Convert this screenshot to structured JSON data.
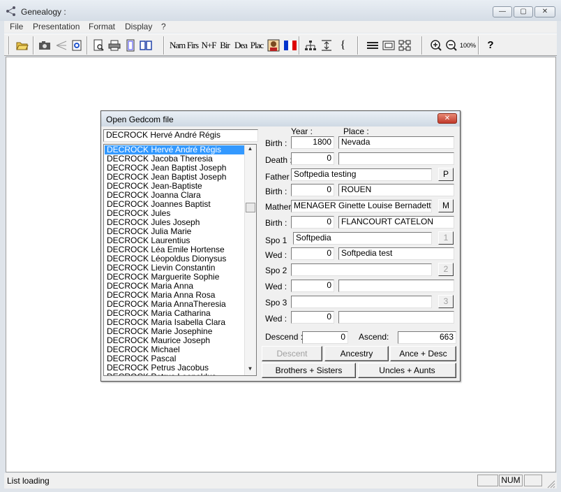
{
  "window": {
    "title": "Genealogy :"
  },
  "window_buttons": {
    "minimize": "—",
    "maximize": "▢",
    "close": "✕"
  },
  "menu": [
    "File",
    "Presentation",
    "Format",
    "Display",
    "?"
  ],
  "toolbar": {
    "name_label": "Nam",
    "first_label": "Firs",
    "nf_label": "N+F",
    "birth_label": "Bir",
    "death_label": "Dea",
    "place_label": "Plac",
    "zoom100_label": "100%",
    "brace_label": "{",
    "help_label": "?"
  },
  "dialog": {
    "title": "Open Gedcom file",
    "search_value": "DECROCK Hervé André Régis",
    "list_items": [
      "DECROCK Hervé André Régis",
      "DECROCK Jacoba Theresia",
      "DECROCK Jean Baptist Joseph",
      "DECROCK Jean Baptist Joseph",
      "DECROCK Jean-Baptiste",
      "DECROCK Joanna Clara",
      "DECROCK Joannes Baptist",
      "DECROCK Jules",
      "DECROCK Jules Joseph",
      "DECROCK Julia Marie",
      "DECROCK Laurentius",
      "DECROCK Léa Emile Hortense",
      "DECROCK Léopoldus Dionysus",
      "DECROCK Lievin Constantin",
      "DECROCK Marguerite Sophie",
      "DECROCK Maria Anna",
      "DECROCK Maria Anna Rosa",
      "DECROCK Maria AnnaTheresia",
      "DECROCK Maria Catharina",
      "DECROCK Maria Isabella Clara",
      "DECROCK Marie Josephine",
      "DECROCK Maurice Joseph",
      "DECROCK Michael",
      "DECROCK Pascal",
      "DECROCK Petrus Jacobus",
      "DECROCK Petrus Leopoldus"
    ],
    "year_header": "Year :",
    "place_header": "Place :",
    "birth_label": "Birth :",
    "birth_year": "1800",
    "birth_place": "Nevada",
    "death_label": "Death :",
    "death_year": "0",
    "death_place": "",
    "father_label": "Father :",
    "father_value": "Softpedia testing",
    "father_btn": "P",
    "father_birth_label": "Birth :",
    "father_birth_year": "0",
    "father_birth_place": "ROUEN",
    "mother_label": "Mather",
    "mother_value": "MENAGER Ginette Louise Bernadette",
    "mother_btn": "M",
    "mother_birth_label": "Birth :",
    "mother_birth_year": "0",
    "mother_birth_place": "FLANCOURT CATELON",
    "spouse1_label": "Spo 1",
    "spouse1_value": "Softpedia",
    "spouse1_btn": "1",
    "wed1_label": "Wed :",
    "wed1_year": "0",
    "wed1_place": "Softpedia test",
    "spouse2_label": "Spo 2",
    "spouse2_value": "",
    "spouse2_btn": "2",
    "wed2_label": "Wed :",
    "wed2_year": "0",
    "wed2_place": "",
    "spouse3_label": "Spo 3",
    "spouse3_value": "",
    "spouse3_btn": "3",
    "wed3_label": "Wed :",
    "wed3_year": "0",
    "wed3_place": "",
    "descend_label": "Descend :",
    "descend_value": "0",
    "ascend_label": "Ascend:",
    "ascend_value": "663",
    "descent_btn": "Descent",
    "ancestry_btn": "Ancestry",
    "ance_desc_btn": "Ance  + Desc",
    "brothers_btn": "Brothers + Sisters",
    "uncles_btn": "Uncles + Aunts"
  },
  "status": {
    "text": "List loading",
    "num": "NUM"
  }
}
